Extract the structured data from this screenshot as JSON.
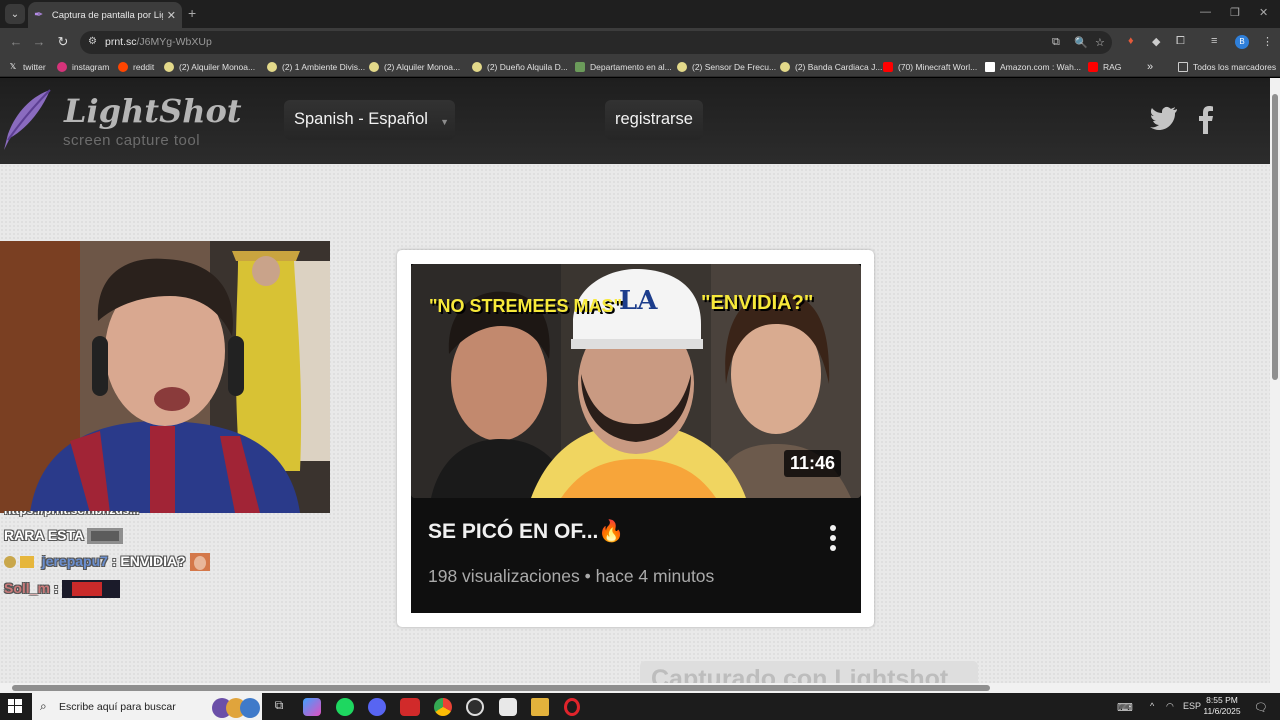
{
  "browser": {
    "tab_title": "Captura de pantalla por Lightsh",
    "url_host": "prnt.sc",
    "url_path": "/J6MYg-WbXUp",
    "bookmarks": [
      "twitter",
      "instagram",
      "reddit",
      "(2) Alquiler Monoa...",
      "(2) 1 Ambiente Divis...",
      "(2) Alquiler Monoa...",
      "(2) Dueño Alquila D...",
      "Departamento en al...",
      "(2) Sensor De Frecu...",
      "(2) Banda Cardiaca J...",
      "(70) Minecraft Worl...",
      "Amazon.com : Wah...",
      "RAG"
    ],
    "bookmarks_overflow": "»",
    "all_bookmarks": "Todos los marcadores",
    "profile_initial": "B"
  },
  "lightshot": {
    "logo_title": "LightShot",
    "logo_subtitle": "screen capture tool",
    "language": "Spanish - Español",
    "register": "registrarse"
  },
  "chat": [
    {
      "user": "",
      "text": "https://prnt.sc/nbhzds..."
    },
    {
      "user": "",
      "text": "RARA ESTA"
    },
    {
      "user": "jerepapu7",
      "text": ": ENVIDIA?"
    },
    {
      "user": "Soll_m",
      "text": ":"
    }
  ],
  "video": {
    "thumb_text_left": "\"NO STREMEES MAS\"",
    "thumb_text_right": "\"ENVIDIA?\"",
    "duration": "11:46",
    "title": "SE PICÓ EN OF...🔥",
    "meta": "198 visualizaciones • hace 4 minutos"
  },
  "watermark": "Capturado con Lightshot",
  "taskbar": {
    "search_placeholder": "Escribe aquí para buscar",
    "language": "ESP",
    "time": "8:55 PM",
    "date": "11/6/2025"
  },
  "colors": {
    "page_bg": "#e9e9e9",
    "header_bg": "#252525",
    "youtube_bg": "#0f0f0f",
    "chat_username": "#6a8fd0"
  }
}
